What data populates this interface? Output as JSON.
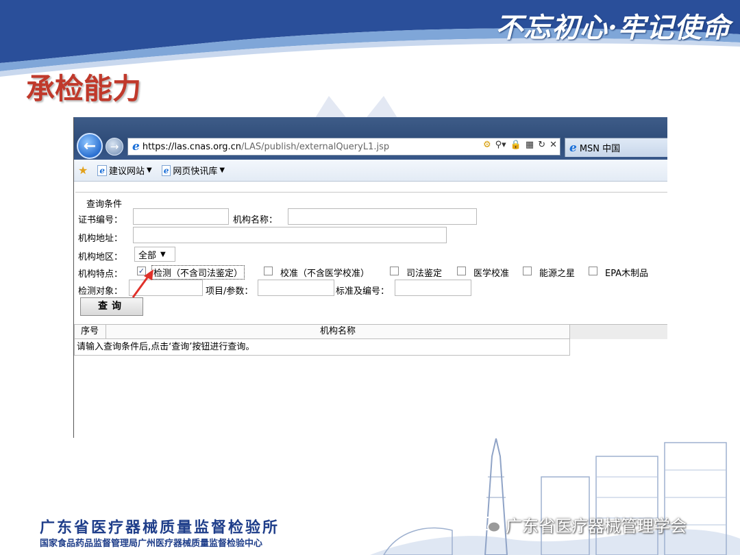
{
  "slide": {
    "slogan": "不忘初心·牢记使命",
    "title": "承检能力"
  },
  "browser": {
    "url_scheme": "https://",
    "url_domain": "las.cnas.org.cn",
    "url_path": "/LAS/publish/externalQueryL1.jsp",
    "tab_title": "MSN 中国",
    "favorites": [
      {
        "label": "建议网站"
      },
      {
        "label": "网页快讯库"
      }
    ]
  },
  "form": {
    "legend": "查询条件",
    "cert_no_label": "证书编号：",
    "org_name_label": "机构名称：",
    "org_address_label": "机构地址：",
    "region_label": "机构地区：",
    "region_value": "全部",
    "features_label": "机构特点：",
    "features": [
      {
        "label": "检测（不含司法鉴定）",
        "checked": true
      },
      {
        "label": "校准（不含医学校准）",
        "checked": false
      },
      {
        "label": "司法鉴定",
        "checked": false
      },
      {
        "label": "医学校准",
        "checked": false
      },
      {
        "label": "能源之星",
        "checked": false
      },
      {
        "label": "EPA木制品",
        "checked": false
      }
    ],
    "test_object_label": "检测对象：",
    "item_param_label": "项目/参数：",
    "standard_label": "标准及编号：",
    "search_button": "查询"
  },
  "results": {
    "col_index": "序号",
    "col_name": "机构名称",
    "message": "请输入查询条件后,点击‘查询’按钮进行查询。"
  },
  "footer": {
    "org_name": "广东省医疗器械质量监督检验所",
    "org_sub": "国家食品药品监督管理局广州医疗器械质量监督检验中心",
    "wechat_account": "广东省医疗器械管理学会"
  },
  "colors": {
    "title_red": "#c0392b",
    "org_blue": "#1f3e8a",
    "browser_frame": "#2e4b78"
  }
}
